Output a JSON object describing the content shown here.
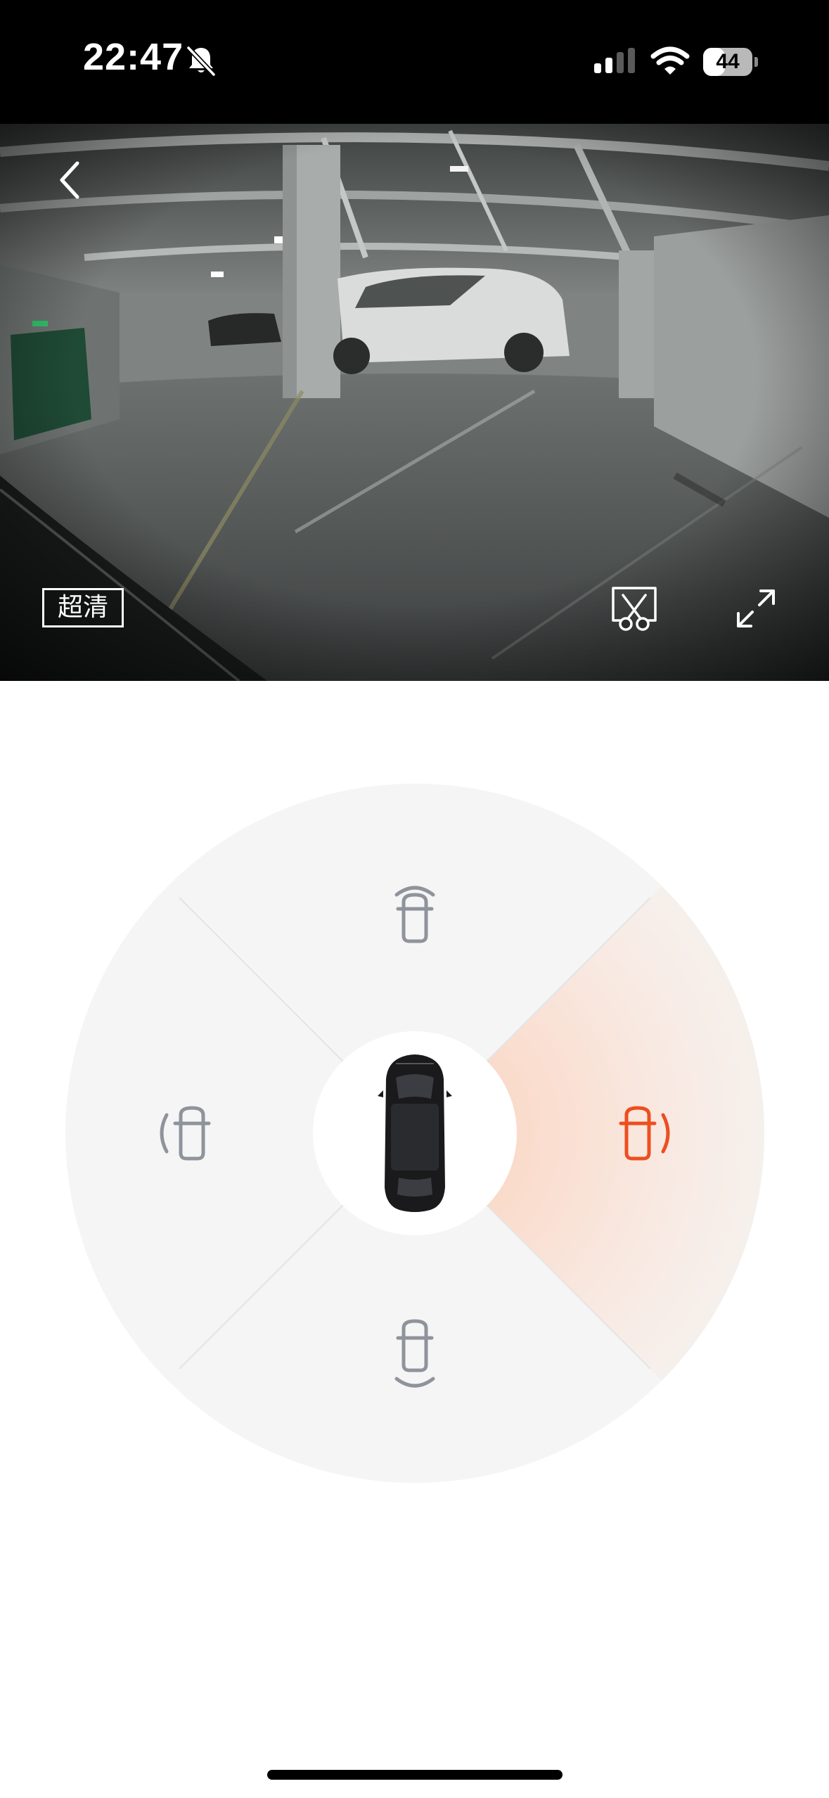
{
  "status_bar": {
    "time": "22:47",
    "battery_level": "44",
    "battery_fraction": 0.44
  },
  "camera": {
    "quality_label": "超清",
    "active_view": "right"
  },
  "directions": [
    {
      "id": "front",
      "icon": "car-front-camera-icon",
      "active": false
    },
    {
      "id": "left",
      "icon": "car-left-camera-icon",
      "active": false
    },
    {
      "id": "right",
      "icon": "car-right-camera-icon",
      "active": true
    },
    {
      "id": "rear",
      "icon": "car-rear-camera-icon",
      "active": false
    }
  ],
  "colors": {
    "accent": "#ee4e1f",
    "inactive_icon": "#8f939b",
    "wheel_background": "#f5f5f5",
    "status_bar": "#000000"
  }
}
